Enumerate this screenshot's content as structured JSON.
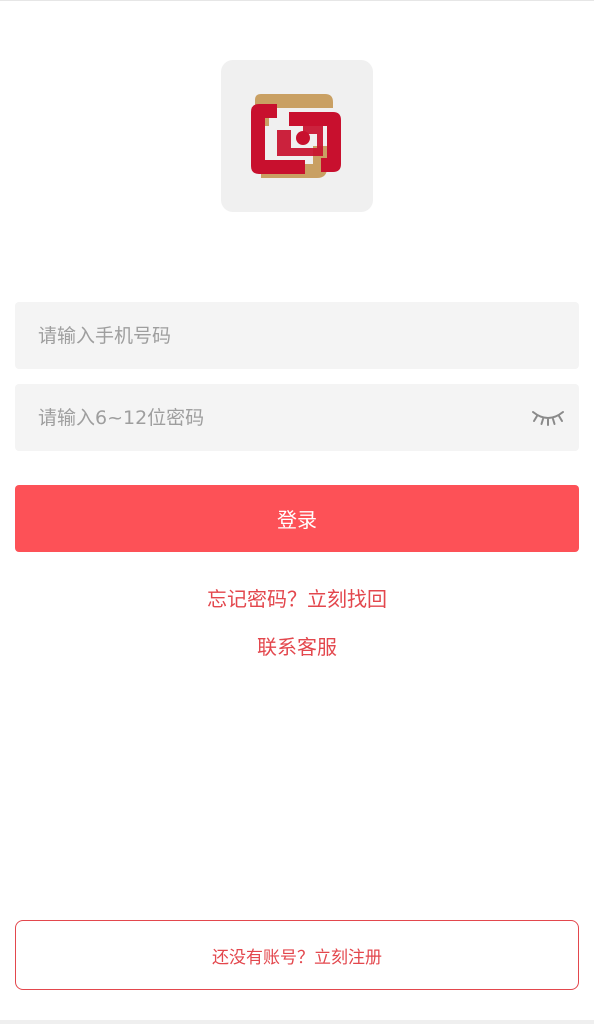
{
  "logo": {
    "icon": "bank-logo-icon",
    "colors": {
      "red": "#c8102e",
      "gold": "#c9a063"
    }
  },
  "form": {
    "phone_placeholder": "请输入手机号码",
    "password_placeholder": "请输入6~12位密码",
    "password_toggle_icon": "eye-closed-icon",
    "login_label": "登录"
  },
  "links": {
    "forgot_password": "忘记密码？立刻找回",
    "contact_service": "联系客服"
  },
  "register": {
    "label": "还没有账号？立刻注册"
  },
  "colors": {
    "primary": "#fd5157",
    "link": "#e3474d",
    "field_bg": "#f4f4f4"
  }
}
